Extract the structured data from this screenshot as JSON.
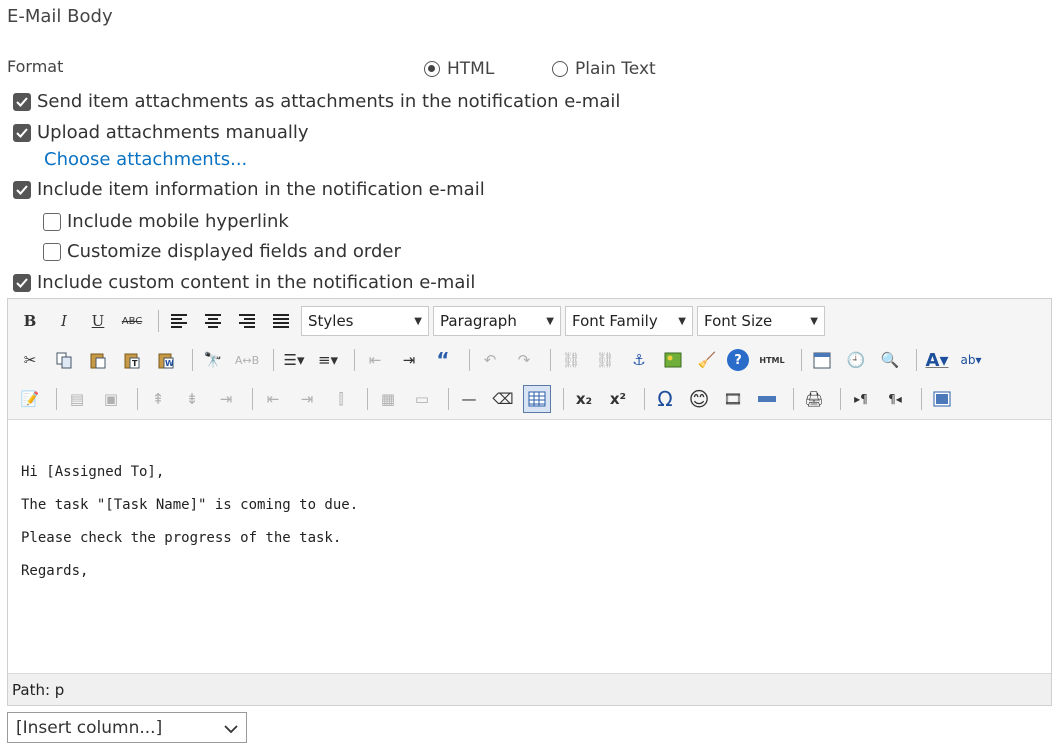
{
  "header": {
    "title": "E-Mail Body"
  },
  "format": {
    "label": "Format",
    "options": [
      {
        "label": "HTML",
        "selected": true
      },
      {
        "label": "Plain Text",
        "selected": false
      }
    ]
  },
  "checkboxes": {
    "send_attachments": {
      "label": "Send item attachments as attachments in the notification e-mail",
      "checked": true
    },
    "upload_manually": {
      "label": "Upload attachments manually",
      "checked": true
    },
    "choose_link": "Choose attachments...",
    "include_info": {
      "label": "Include item information in the notification e-mail",
      "checked": true
    },
    "mobile_link": {
      "label": "Include mobile hyperlink",
      "checked": false
    },
    "customize_fields": {
      "label": "Customize displayed fields and order",
      "checked": false
    },
    "custom_content": {
      "label": "Include custom content in the notification e-mail",
      "checked": true
    }
  },
  "toolbar": {
    "styles": "Styles",
    "paragraph": "Paragraph",
    "font_family": "Font Family",
    "font_size": "Font Size",
    "html_button": "HTML"
  },
  "editor": {
    "lines": [
      "Hi [Assigned To],",
      "The task \"[Task Name]\" is coming to due.",
      "Please check the progress of the task.",
      "Regards,"
    ],
    "path": "Path: p"
  },
  "insert_column": {
    "value": "[Insert column...]"
  },
  "colors": {
    "link": "#0a72c2",
    "checkbox": "#555555"
  }
}
